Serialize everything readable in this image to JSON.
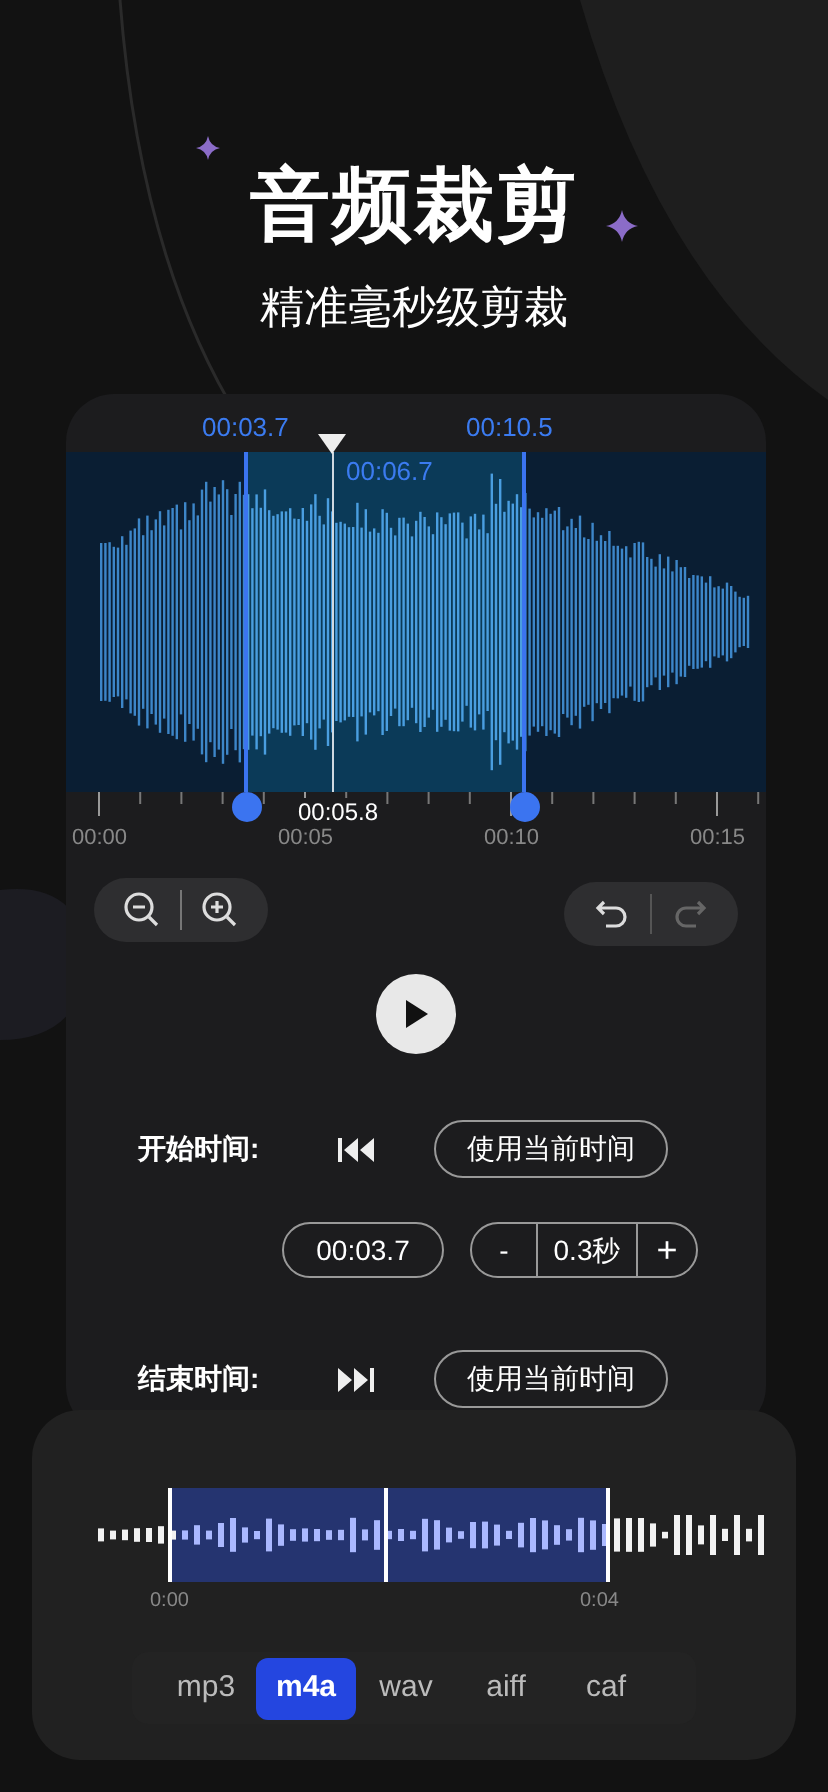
{
  "header": {
    "title": "音频裁剪",
    "subtitle": "精准毫秒级剪裁"
  },
  "editor": {
    "start_marker": "00:03.7",
    "end_marker": "00:10.5",
    "playhead": "00:06.7",
    "cursor_time": "00:05.8",
    "ruler_labels": [
      "00:00",
      "00:05",
      "00:10",
      "00:15"
    ]
  },
  "history": {
    "undo": {
      "disabled": false
    },
    "redo": {
      "disabled": true
    }
  },
  "start_time": {
    "label": "开始时间:",
    "button": "使用当前时间",
    "value": "00:03.7",
    "step": {
      "minus": "-",
      "value": "0.3秒",
      "plus": "+"
    }
  },
  "end_time": {
    "label": "结束时间:",
    "button": "使用当前时间"
  },
  "preview": {
    "start": "0:00",
    "end": "0:04"
  },
  "formats": [
    {
      "label": "mp3",
      "selected": false
    },
    {
      "label": "m4a",
      "selected": true
    },
    {
      "label": "wav",
      "selected": false
    },
    {
      "label": "aiff",
      "selected": false
    },
    {
      "label": "caf",
      "selected": false
    }
  ]
}
